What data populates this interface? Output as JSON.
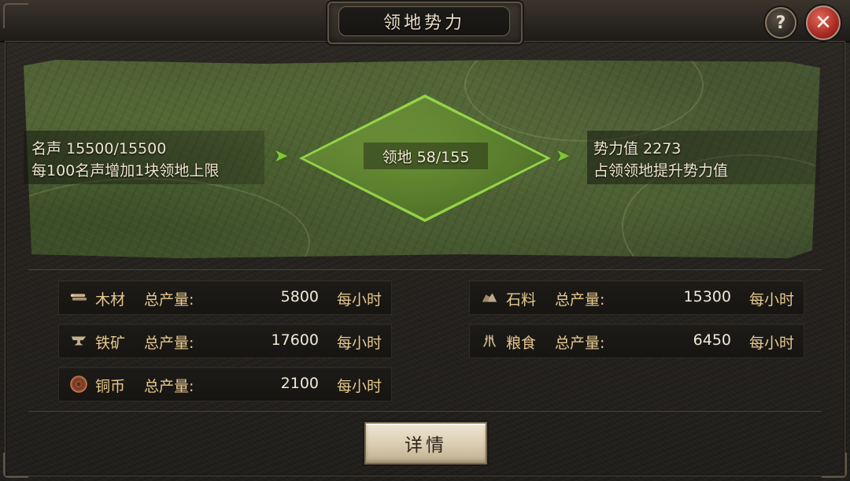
{
  "window": {
    "title": "领地势力",
    "help_label": "?",
    "close_label": "✕"
  },
  "territory": {
    "fame_line": "名声 15500/15500",
    "fame_desc": "每100名声增加1块领地上限",
    "territory_label": "领地 58/155",
    "power_line": "势力值 2273",
    "power_desc": "占领领地提升势力值",
    "arrow_glyph": "➤"
  },
  "resources": [
    {
      "icon": "wood-icon",
      "name": "木材",
      "label": "总产量:",
      "value": "5800",
      "unit": "每小时"
    },
    {
      "icon": "stone-icon",
      "name": "石料",
      "label": "总产量:",
      "value": "15300",
      "unit": "每小时"
    },
    {
      "icon": "iron-icon",
      "name": "铁矿",
      "label": "总产量:",
      "value": "17600",
      "unit": "每小时"
    },
    {
      "icon": "grain-icon",
      "name": "粮食",
      "label": "总产量:",
      "value": "6450",
      "unit": "每小时"
    },
    {
      "icon": "copper-coin-icon",
      "name": "铜币",
      "label": "总产量:",
      "value": "2100",
      "unit": "每小时"
    }
  ],
  "detail_button": "详情",
  "colors": {
    "accent_gold": "#e6c98e",
    "territory_glow": "#9be04a",
    "close_red": "#a82a22"
  }
}
